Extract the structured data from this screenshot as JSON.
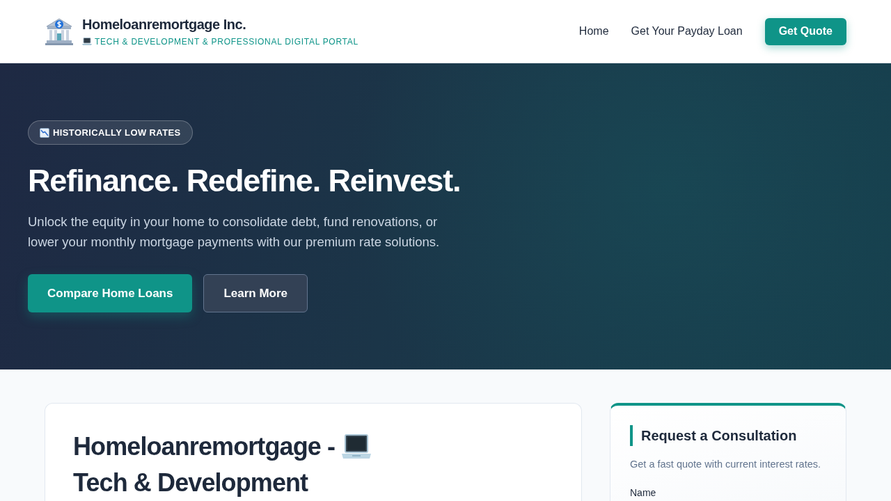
{
  "header": {
    "brand": "Homeloanremortgage Inc.",
    "tagline": "TECH & DEVELOPMENT & PROFESSIONAL DIGITAL PORTAL",
    "nav": [
      {
        "label": "Home"
      },
      {
        "label": "Get Your Payday Loan"
      }
    ],
    "cta": "Get Quote"
  },
  "hero": {
    "badge": "HISTORICALLY LOW RATES",
    "title": "Refinance. Redefine. Reinvest.",
    "text": "Unlock the equity in your home to consolidate debt, fund renovations, or lower your monthly mortgage payments with our premium rate solutions.",
    "buttons": [
      {
        "label": "Compare Home Loans",
        "kind": "primary"
      },
      {
        "label": "Learn More",
        "kind": "secondary"
      }
    ]
  },
  "article": {
    "title_start": "Homeloanremortgage -",
    "title_end": "Tech & Development"
  },
  "consultation": {
    "title": "Request a Consultation",
    "text": "Get a fast quote with current interest rates.",
    "fields": [
      {
        "label": "Name"
      }
    ]
  }
}
